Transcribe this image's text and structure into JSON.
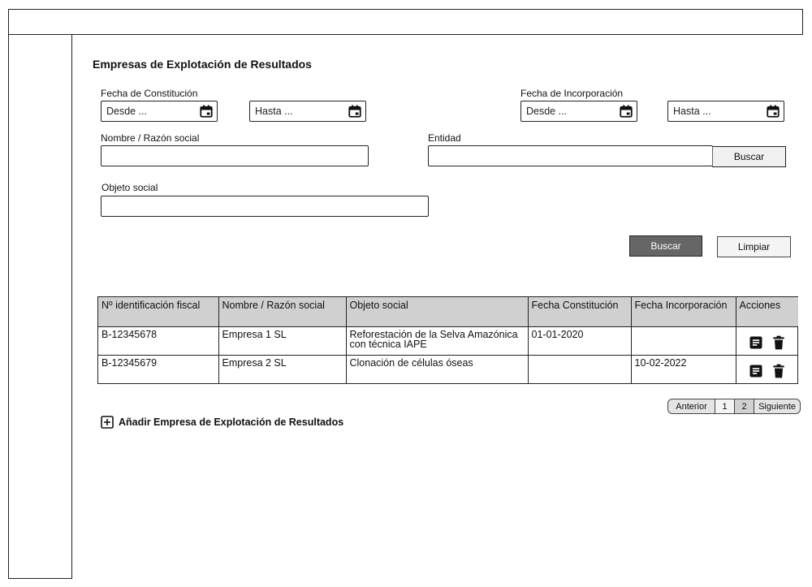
{
  "page": {
    "title": "Empresas de Explotación de Resultados"
  },
  "filters": {
    "fecha_constitucion": {
      "label": "Fecha de Constitución",
      "desde_placeholder": "Desde ...",
      "hasta_placeholder": "Hasta ..."
    },
    "fecha_incorporacion": {
      "label": "Fecha de Incorporación",
      "desde_placeholder": "Desde ...",
      "hasta_placeholder": "Hasta ..."
    },
    "nombre": {
      "label": "Nombre / Razón social",
      "value": ""
    },
    "entidad": {
      "label": "Entidad",
      "value": "",
      "button_label": "Buscar"
    },
    "objeto_social": {
      "label": "Objeto social",
      "value": ""
    }
  },
  "actions": {
    "search_label": "Buscar",
    "clear_label": "Limpiar"
  },
  "table": {
    "columns": [
      "Nº identificación fiscal",
      "Nombre / Razón social",
      "Objeto social",
      "Fecha Constitución",
      "Fecha Incorporación",
      "Acciones"
    ],
    "rows": [
      {
        "nif": "B-12345678",
        "nombre": "Empresa 1 SL",
        "objeto": "Reforestación de la Selva Amazónica con técnica IAPE",
        "fecha_constitucion": "01-01-2020",
        "fecha_incorporacion": ""
      },
      {
        "nif": "B-12345679",
        "nombre": "Empresa 2 SL",
        "objeto": "Clonación de células óseas",
        "fecha_constitucion": "",
        "fecha_incorporacion": "10-02-2022"
      }
    ],
    "row_action_icons": [
      "document-icon",
      "trash-icon"
    ]
  },
  "pagination": {
    "prev_label": "Anterior",
    "pages": [
      "1",
      "2"
    ],
    "current_page": "2",
    "next_label": "Siguiente"
  },
  "add": {
    "label": "Añadir Empresa de Explotación de Resultados",
    "icon": "plus-square-icon"
  },
  "colors": {
    "primary_button": "#666666",
    "header_bg": "#d0d0d0",
    "border": "#222222"
  }
}
